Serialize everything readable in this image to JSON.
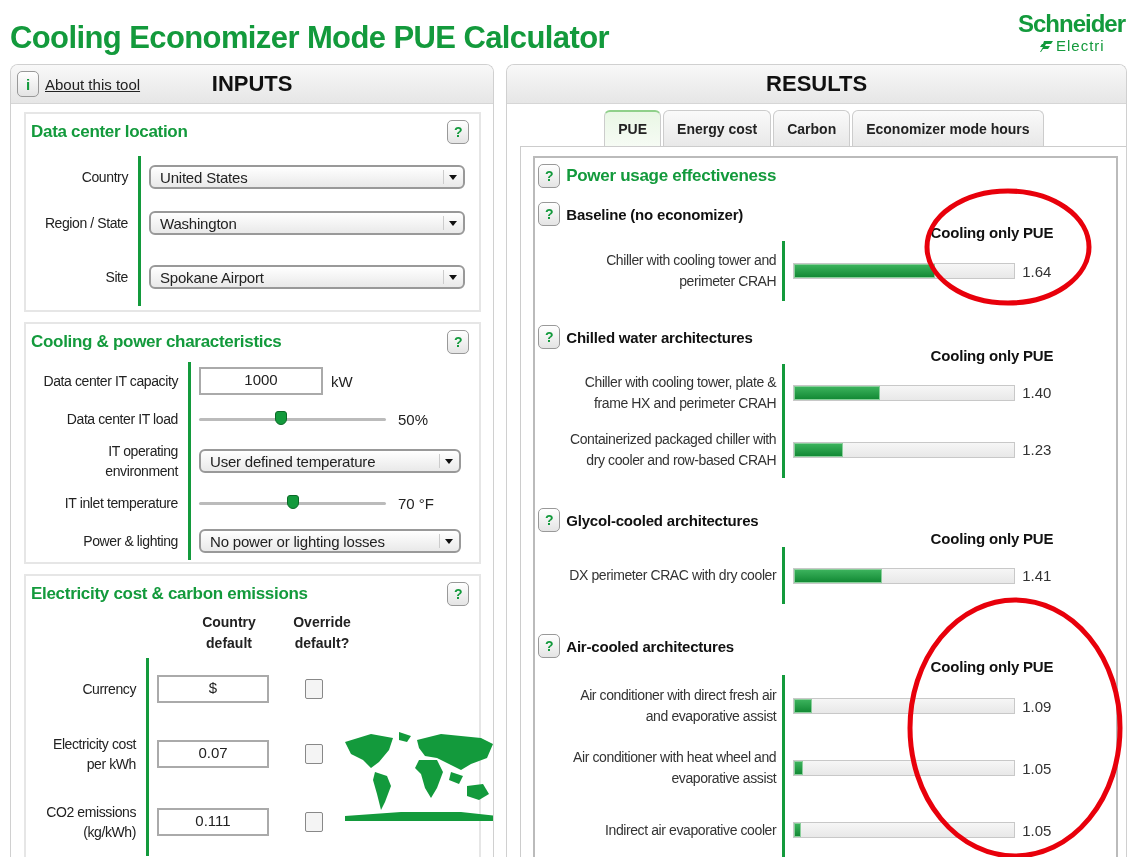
{
  "header": {
    "title": "Cooling Economizer Mode PUE Calculator",
    "logo": {
      "line_1": "Schneider",
      "line_2": "Electri"
    }
  },
  "inputs": {
    "info_icon": "i",
    "about_link": "About this tool",
    "title": "INPUTS",
    "sections": [
      {
        "kind": "location",
        "title": "Data center location",
        "help": "?",
        "fields": [
          {
            "label": "Country",
            "value": "United States"
          },
          {
            "label": "Region / State",
            "value": "Washington"
          },
          {
            "label": "Site",
            "value": "Spokane Airport"
          }
        ]
      },
      {
        "kind": "cooling",
        "title": "Cooling & power characteristics",
        "help": "?",
        "rows": [
          {
            "kind": "text",
            "label": "Data center IT capacity",
            "value": "1000",
            "unit": "kW"
          },
          {
            "kind": "slider",
            "label": "Data center IT load",
            "level": 0.44,
            "reading": "50%"
          },
          {
            "kind": "select",
            "label": "IT operating environment",
            "value": "User defined temperature"
          },
          {
            "kind": "slider",
            "label": "IT inlet temperature",
            "level": 0.5,
            "reading": "70 °F"
          },
          {
            "kind": "select",
            "label": "Power & lighting",
            "value": "No power or lighting losses"
          }
        ]
      },
      {
        "kind": "electricity",
        "title": "Electricity cost & carbon emissions",
        "help": "?",
        "columns": [
          "Country default",
          "Override default?"
        ],
        "rows": [
          {
            "label": "Currency",
            "value": "$",
            "checked": false
          },
          {
            "label": "Electricity cost per kWh",
            "value": "0.07",
            "checked": false
          },
          {
            "label": "CO2 emissions (kg/kWh)",
            "value": "0.111",
            "checked": false
          }
        ]
      }
    ]
  },
  "results": {
    "title": "RESULTS",
    "tabs": [
      {
        "label": "PUE",
        "selected": true
      },
      {
        "label": "Energy cost",
        "selected": false
      },
      {
        "label": "Carbon",
        "selected": false
      },
      {
        "label": "Economizer mode hours",
        "selected": false
      }
    ],
    "help": "?",
    "heading": "Power usage effectiveness",
    "groups": [
      {
        "title": "Baseline (no economizer)",
        "help": "?",
        "column": "Cooling only PUE",
        "circled": true,
        "items": [
          {
            "label": "Chiller with cooling tower and perimeter CRAH",
            "level": 0.64,
            "reading": "1.64"
          }
        ]
      },
      {
        "title": "Chilled water architectures",
        "help": "?",
        "column": "Cooling only PUE",
        "circled": false,
        "items": [
          {
            "label": "Chiller with cooling tower, plate & frame HX and perimeter CRAH",
            "level": 0.39,
            "reading": "1.40"
          },
          {
            "label": "Containerized packaged chiller with dry cooler and row-based CRAH",
            "level": 0.22,
            "reading": "1.23"
          }
        ]
      },
      {
        "title": "Glycol-cooled architectures",
        "help": "?",
        "column": "Cooling only PUE",
        "circled": false,
        "items": [
          {
            "label": "DX perimeter CRAC with dry cooler",
            "level": 0.4,
            "reading": "1.41"
          }
        ]
      },
      {
        "title": "Air-cooled architectures",
        "help": "?",
        "column": "Cooling only PUE",
        "circled": true,
        "items": [
          {
            "label": "Air conditioner with direct fresh air and evaporative assist",
            "level": 0.08,
            "reading": "1.09"
          },
          {
            "label": "Air conditioner with heat wheel and evaporative assist",
            "level": 0.04,
            "reading": "1.05"
          },
          {
            "label": "Indirect air evaporative cooler",
            "level": 0.03,
            "reading": "1.05"
          }
        ]
      }
    ]
  }
}
